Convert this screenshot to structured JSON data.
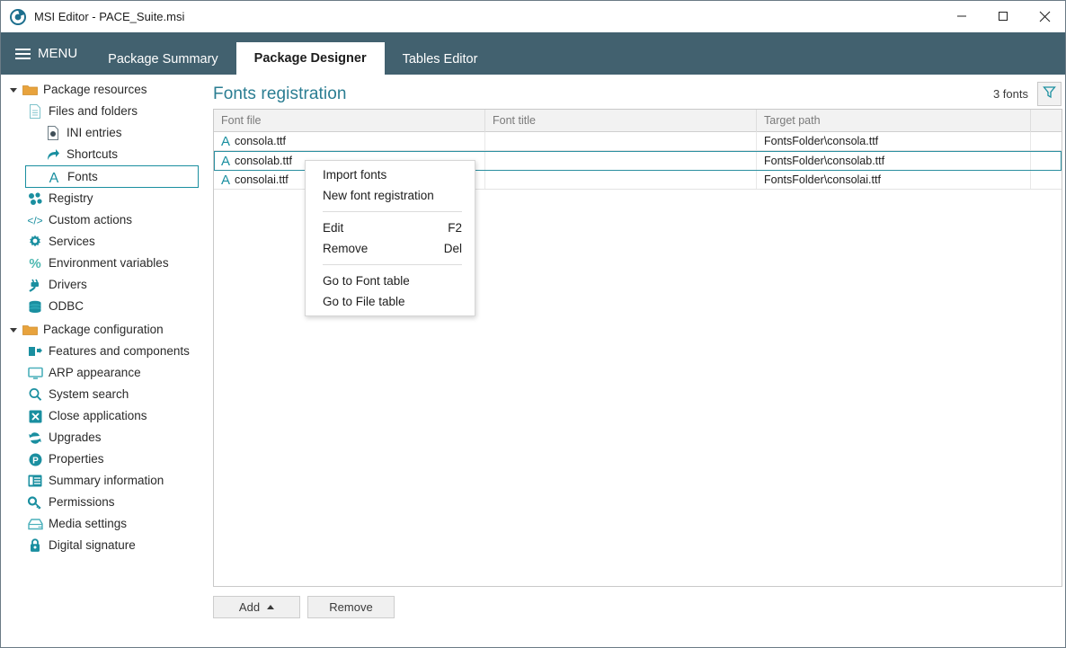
{
  "window": {
    "title": "MSI Editor - PACE_Suite.msi",
    "app_icon": "pace-logo-icon",
    "controls": [
      {
        "name": "minimize-button",
        "glyph": "minimize-icon"
      },
      {
        "name": "maximize-button",
        "glyph": "maximize-icon"
      },
      {
        "name": "close-button",
        "glyph": "close-icon"
      }
    ]
  },
  "nav": {
    "menu_label": "MENU",
    "tabs": [
      {
        "label": "Package Summary",
        "active": false
      },
      {
        "label": "Package Designer",
        "active": true
      },
      {
        "label": "Tables Editor",
        "active": false
      }
    ]
  },
  "sidebar": {
    "groups": [
      {
        "label": "Package resources",
        "icon": "folder-icon",
        "expanded": true,
        "items": [
          {
            "label": "Files and folders",
            "icon": "document-icon",
            "level": 1,
            "selected": false
          },
          {
            "label": "INI entries",
            "icon": "ini-file-icon",
            "level": 2,
            "selected": false
          },
          {
            "label": "Shortcuts",
            "icon": "shortcut-arrow-icon",
            "level": 2,
            "selected": false
          },
          {
            "label": "Fonts",
            "icon": "font-a-icon",
            "level": 2,
            "selected": true
          },
          {
            "label": "Registry",
            "icon": "registry-blocks-icon",
            "level": 1,
            "selected": false
          },
          {
            "label": "Custom actions",
            "icon": "code-brackets-icon",
            "level": 1,
            "selected": false
          },
          {
            "label": "Services",
            "icon": "gear-icon",
            "level": 1,
            "selected": false
          },
          {
            "label": "Environment variables",
            "icon": "percent-icon",
            "level": 1,
            "selected": false
          },
          {
            "label": "Drivers",
            "icon": "plug-icon",
            "level": 1,
            "selected": false
          },
          {
            "label": "ODBC",
            "icon": "database-icon",
            "level": 1,
            "selected": false
          }
        ]
      },
      {
        "label": "Package configuration",
        "icon": "folder-icon",
        "expanded": true,
        "items": [
          {
            "label": "Features and components",
            "icon": "features-icon",
            "level": 1,
            "selected": false
          },
          {
            "label": "ARP appearance",
            "icon": "monitor-icon",
            "level": 1,
            "selected": false
          },
          {
            "label": "System search",
            "icon": "search-icon",
            "level": 1,
            "selected": false
          },
          {
            "label": "Close applications",
            "icon": "x-square-icon",
            "level": 1,
            "selected": false
          },
          {
            "label": "Upgrades",
            "icon": "refresh-icon",
            "level": 1,
            "selected": false
          },
          {
            "label": "Properties",
            "icon": "p-circle-icon",
            "level": 1,
            "selected": false
          },
          {
            "label": "Summary information",
            "icon": "list-panel-icon",
            "level": 1,
            "selected": false
          },
          {
            "label": "Permissions",
            "icon": "key-icon",
            "level": 1,
            "selected": false
          },
          {
            "label": "Media settings",
            "icon": "media-drive-icon",
            "level": 1,
            "selected": false
          },
          {
            "label": "Digital signature",
            "icon": "lock-icon",
            "level": 1,
            "selected": false
          }
        ]
      }
    ]
  },
  "main": {
    "page_title": "Fonts registration",
    "count_text": "3 fonts",
    "filter_icon": "filter-funnel-icon",
    "table": {
      "columns": [
        "Font file",
        "Font title",
        "Target path",
        ""
      ],
      "rows": [
        {
          "font_file": "consola.ttf",
          "font_title": "",
          "target_path": "FontsFolder\\consola.ttf",
          "selected": false
        },
        {
          "font_file": "consolab.ttf",
          "font_title": "",
          "target_path": "FontsFolder\\consolab.ttf",
          "selected": true
        },
        {
          "font_file": "consolai.ttf",
          "font_title": "",
          "target_path": "FontsFolder\\consolai.ttf",
          "selected": false
        }
      ]
    },
    "footer_buttons": [
      {
        "label": "Add",
        "has_dropdown": true
      },
      {
        "label": "Remove",
        "has_dropdown": false
      }
    ]
  },
  "context_menu": {
    "items": [
      {
        "label": "Import fonts",
        "accel": "",
        "type": "item"
      },
      {
        "label": "New font registration",
        "accel": "",
        "type": "item"
      },
      {
        "type": "separator"
      },
      {
        "label": "Edit",
        "accel": "F2",
        "type": "item"
      },
      {
        "label": "Remove",
        "accel": "Del",
        "type": "item"
      },
      {
        "type": "separator"
      },
      {
        "label": "Go to Font table",
        "accel": "",
        "type": "item"
      },
      {
        "label": "Go to File table",
        "accel": "",
        "type": "item"
      }
    ]
  },
  "colors": {
    "nav_bar": "#42616f",
    "accent_teal": "#1a8fa0",
    "title_teal": "#2a7d92",
    "folder_orange": "#e8a33d",
    "selection_border": "#2a8fa0"
  }
}
